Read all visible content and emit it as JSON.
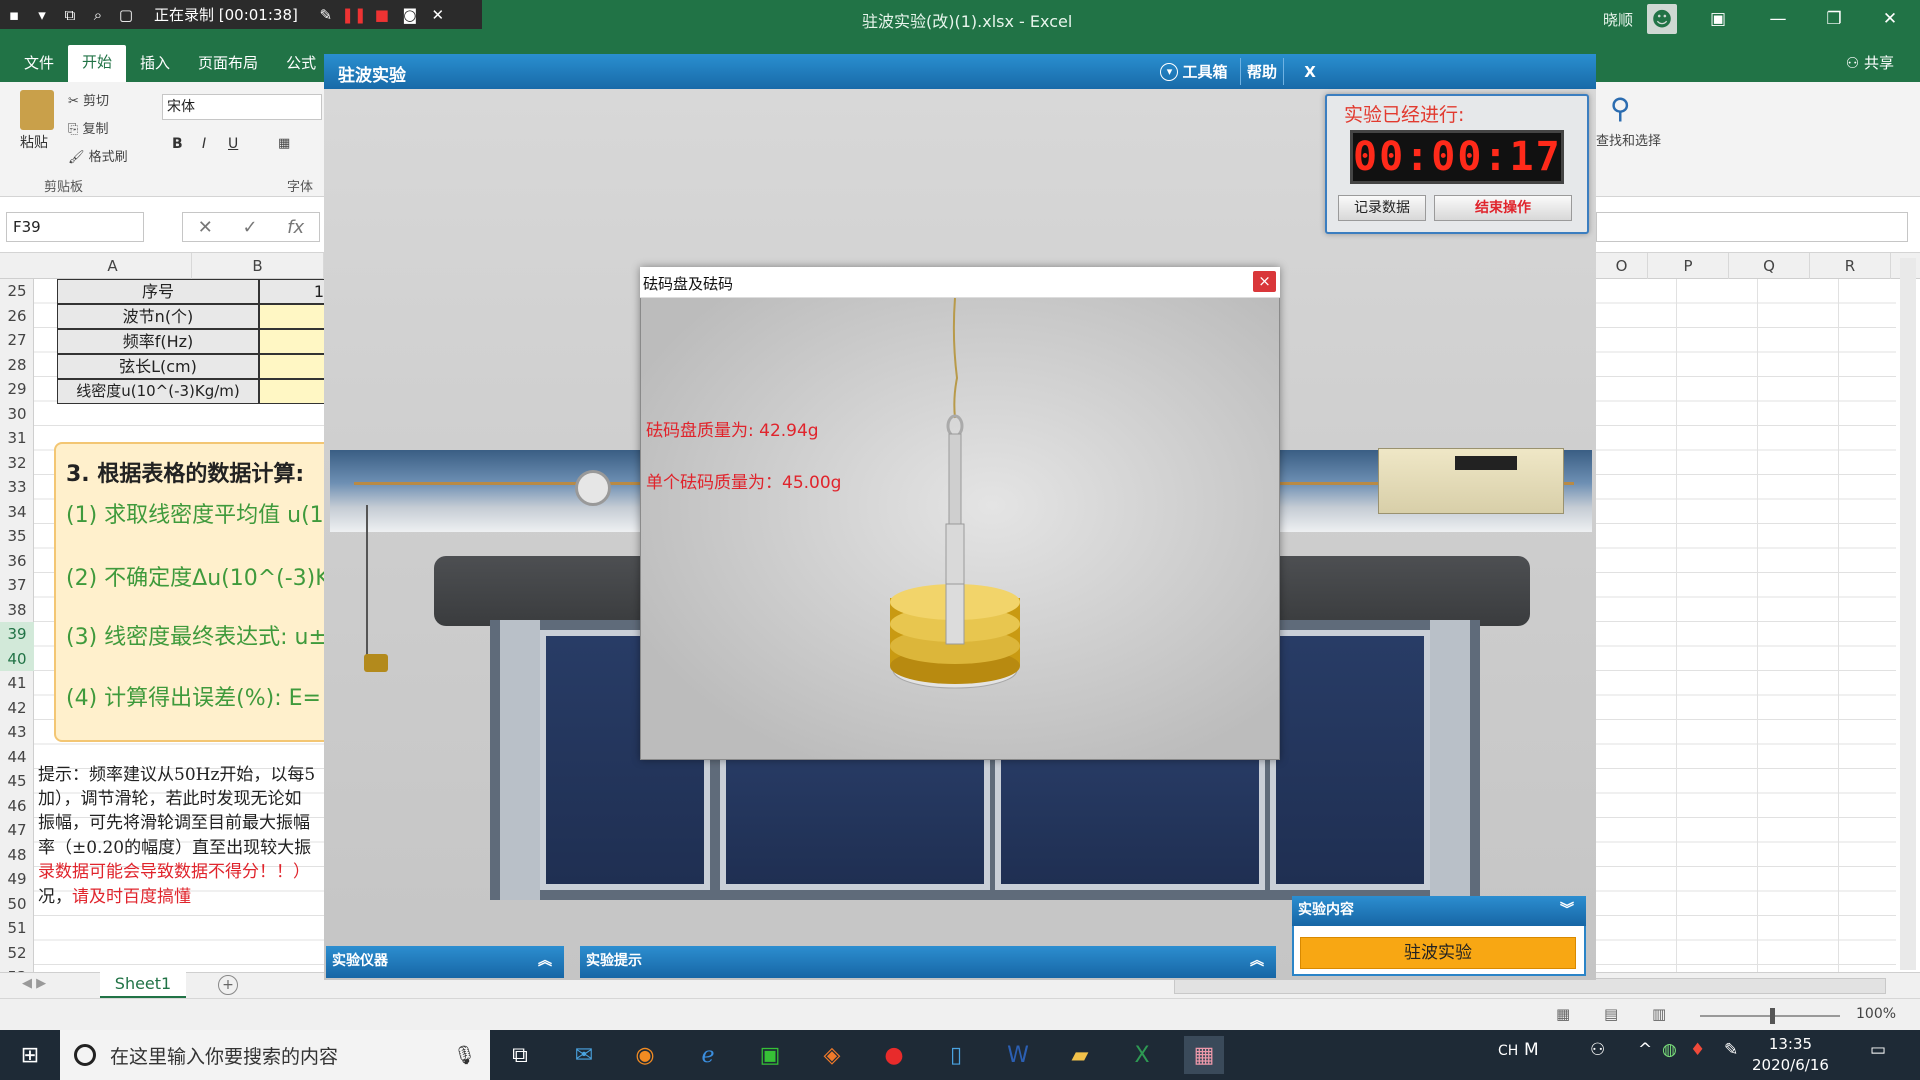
{
  "recorder": {
    "status": "正在录制 [00:01:38]"
  },
  "excel": {
    "title": "驻波实验(改)(1).xlsx  -  Excel",
    "user": "晓顺",
    "tabs": [
      "文件",
      "开始",
      "插入",
      "页面布局",
      "公式"
    ],
    "active_tab": "开始",
    "share": "共享",
    "clipboard": {
      "paste": "粘贴",
      "cut": "剪切",
      "copy": "复制",
      "format_painter": "格式刷",
      "group": "剪贴板"
    },
    "font": {
      "name": "宋体",
      "bold": "B",
      "italic": "I",
      "underline": "U",
      "group": "字体"
    },
    "find_select": "查找和选择",
    "name_box": "F39",
    "fx": "fx",
    "columns_left": [
      "A",
      "B"
    ],
    "columns_right": [
      "O",
      "P",
      "Q",
      "R"
    ],
    "rows": [
      "25",
      "26",
      "27",
      "28",
      "29",
      "30",
      "31",
      "32",
      "33",
      "34",
      "35",
      "36",
      "37",
      "38",
      "39",
      "40",
      "41",
      "42",
      "43",
      "44",
      "45",
      "46",
      "47",
      "48",
      "49",
      "50",
      "51",
      "52",
      "53"
    ],
    "table": {
      "headers": [
        "序号",
        "波节n(个)",
        "频率f(Hz)",
        "弦长L(cm)",
        "线密度u(10^(-3)Kg/m)"
      ],
      "col1_first": "1"
    },
    "calc": {
      "title": "3. 根据表格的数据计算:",
      "items": [
        "(1) 求取线密度平均值 u(1",
        "(2) 不确定度Δu(10^(-3)K",
        "(3) 线密度最终表达式: u±",
        "(4) 计算得出误差(%): E="
      ]
    },
    "hints": [
      "提示：频率建议从50Hz开始，以每5",
      "加），调节滑轮，若此时发现无论如",
      "振幅，可先将滑轮调至目前最大振幅",
      "率（±0.20的幅度）直至出现较大振",
      "录数据可能会导致数据不得分！！）",
      "况，请及时百度搞懂"
    ],
    "hint_last_prefix": "况，",
    "hint_last_red": "请及时百度搞懂",
    "sheet": "Sheet1",
    "zoom": "100%"
  },
  "sim": {
    "title": "驻波实验",
    "toolbox": "工具箱",
    "help": "帮助",
    "close": "X",
    "timer": {
      "label": "实验已经进行:",
      "value": "00:00:17",
      "record_btn": "记录数据",
      "end_btn": "结束操作"
    },
    "modal": {
      "title": "砝码盘及砝码",
      "close": "×",
      "pan_mass": "砝码盘质量为:   42.94g",
      "weight_mass": "单个砝码质量为：45.00g"
    },
    "panels": {
      "instruments": "实验仪器",
      "tips": "实验提示",
      "content": "实验内容",
      "content_btn": "驻波实验"
    }
  },
  "taskbar": {
    "search_placeholder": "在这里输入你要搜索的内容",
    "ime": "CH",
    "time": "13:35",
    "date": "2020/6/16"
  }
}
